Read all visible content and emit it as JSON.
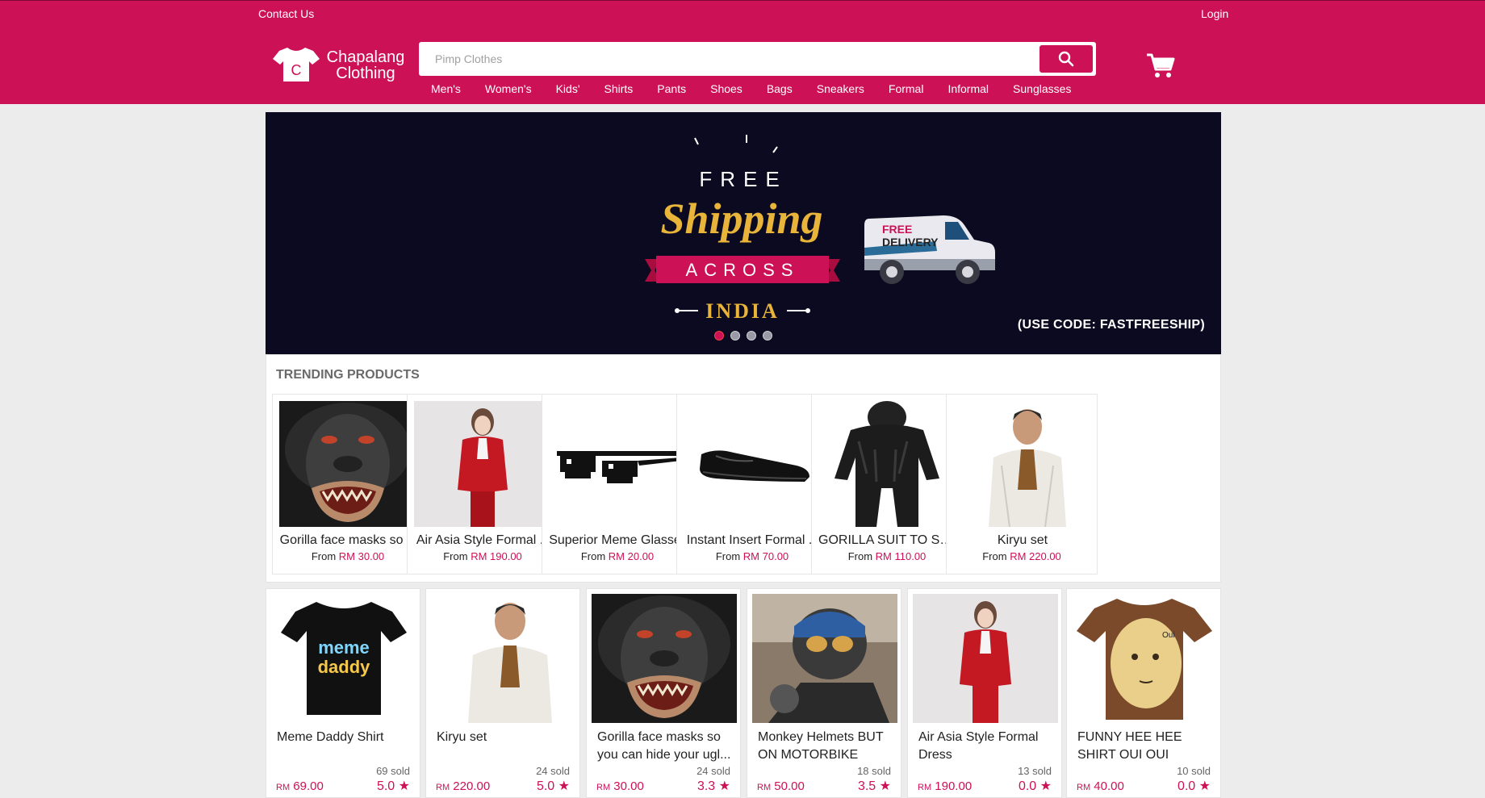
{
  "header": {
    "contact_label": "Contact Us",
    "login_label": "Login",
    "logo_line1": "Chapalang",
    "logo_line2": "Clothing",
    "logo_letter": "C",
    "search_placeholder": "Pimp Clothes",
    "categories": [
      "Men's",
      "Women's",
      "Kids'",
      "Shirts",
      "Pants",
      "Shoes",
      "Bags",
      "Sneakers",
      "Formal",
      "Informal",
      "Sunglasses"
    ]
  },
  "banner": {
    "free": "FREE",
    "shipping": "Shipping",
    "across": "ACROSS",
    "india": "INDIA",
    "van_line1": "FREE",
    "van_line2": "DELIVERY",
    "code": "(USE CODE: FASTFREESHIP)",
    "slides": 4,
    "active_slide": 1
  },
  "trending": {
    "title": "TRENDING PRODUCTS",
    "from_label": "From",
    "items": [
      {
        "name": "Gorilla face masks so ...",
        "price": "RM 30.00",
        "image": "gorilla-mask"
      },
      {
        "name": "Air Asia Style Formal ...",
        "price": "RM 190.00",
        "image": "red-suit"
      },
      {
        "name": "Superior Meme Glasses",
        "price": "RM 20.00",
        "image": "pixel-glasses"
      },
      {
        "name": "Instant Insert Formal ...",
        "price": "RM 70.00",
        "image": "black-shoe"
      },
      {
        "name": "GORILLA SUIT TO SC...",
        "price": "RM 110.00",
        "image": "gorilla-suit"
      },
      {
        "name": "Kiryu set",
        "price": "RM 220.00",
        "image": "kiryu"
      }
    ]
  },
  "products": [
    {
      "name": "Meme Daddy Shirt",
      "sold": "69 sold",
      "currency": "RM",
      "price": "69.00",
      "rating": "5.0",
      "image": "meme-shirt"
    },
    {
      "name": "Kiryu set",
      "sold": "24 sold",
      "currency": "RM",
      "price": "220.00",
      "rating": "5.0",
      "image": "kiryu"
    },
    {
      "name": "Gorilla face masks so you can hide your ugl...",
      "sold": "24 sold",
      "currency": "RM",
      "price": "30.00",
      "rating": "3.3",
      "image": "gorilla-mask"
    },
    {
      "name": "Monkey Helmets BUT ON MOTORBIKE",
      "sold": "18 sold",
      "currency": "RM",
      "price": "50.00",
      "rating": "3.5",
      "image": "monkey-helmet"
    },
    {
      "name": "Air Asia Style Formal Dress",
      "sold": "13 sold",
      "currency": "RM",
      "price": "190.00",
      "rating": "0.0",
      "image": "red-suit"
    },
    {
      "name": "FUNNY HEE HEE SHIRT OUI OUI",
      "sold": "10 sold",
      "currency": "RM",
      "price": "40.00",
      "rating": "0.0",
      "image": "oui-shirt"
    }
  ],
  "colors": {
    "brand": "#cc1156",
    "banner_bg": "#0b0a20",
    "gold": "#e8b43a"
  }
}
